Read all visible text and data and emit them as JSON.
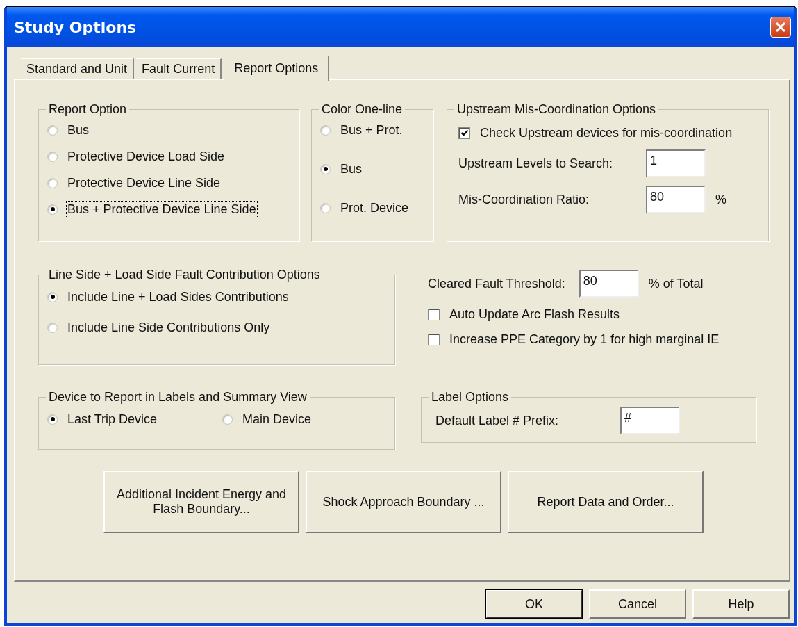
{
  "window": {
    "title": "Study Options"
  },
  "tabs": [
    {
      "label": "Standard and Unit",
      "selected": false
    },
    {
      "label": "Fault Current",
      "selected": false
    },
    {
      "label": "Report Options",
      "selected": true
    }
  ],
  "report_option": {
    "title": "Report Option",
    "options": [
      {
        "label": "Bus",
        "selected": false,
        "focused": false
      },
      {
        "label": "Protective Device Load Side",
        "selected": false,
        "focused": false
      },
      {
        "label": "Protective Device Line Side",
        "selected": false,
        "focused": false
      },
      {
        "label": "Bus + Protective Device Line Side",
        "selected": true,
        "focused": true
      }
    ]
  },
  "color_one_line": {
    "title": "Color One-line",
    "options": [
      {
        "label": "Bus + Prot.",
        "selected": false
      },
      {
        "label": "Bus",
        "selected": true
      },
      {
        "label": "Prot. Device",
        "selected": false
      }
    ]
  },
  "upstream": {
    "title": "Upstream Mis-Coordination Options",
    "check": {
      "label": "Check Upstream devices for mis-coordination",
      "checked": true
    },
    "fields": [
      {
        "label": "Upstream Levels to Search:",
        "value": "1"
      },
      {
        "label": "Mis-Coordination Ratio:",
        "value": "80",
        "unit": "%"
      }
    ]
  },
  "contribution": {
    "title": "Line Side + Load Side Fault Contribution Options",
    "options": [
      {
        "label": "Include Line + Load Sides Contributions",
        "selected": true
      },
      {
        "label": "Include Line Side Contributions Only",
        "selected": false
      }
    ]
  },
  "threshold": {
    "label": "Cleared Fault Threshold:",
    "value": "80",
    "unit": "% of Total"
  },
  "checkboxes": [
    {
      "label": "Auto Update Arc Flash Results",
      "checked": false
    },
    {
      "label": "Increase PPE Category by 1 for high marginal IE",
      "checked": false
    }
  ],
  "device_to_report": {
    "title": "Device to Report in Labels and Summary View",
    "options": [
      {
        "label": "Last Trip Device",
        "selected": true
      },
      {
        "label": "Main Device",
        "selected": false
      }
    ]
  },
  "label_options": {
    "title": "Label Options",
    "field": {
      "label": "Default Label # Prefix:",
      "value": "#"
    }
  },
  "action_buttons": [
    "Additional Incident Energy and Flash Boundary...",
    "Shock Approach Boundary ...",
    "Report Data and Order..."
  ],
  "footer_buttons": [
    {
      "label": "OK",
      "default": true
    },
    {
      "label": "Cancel",
      "default": false
    },
    {
      "label": "Help",
      "default": false
    }
  ]
}
